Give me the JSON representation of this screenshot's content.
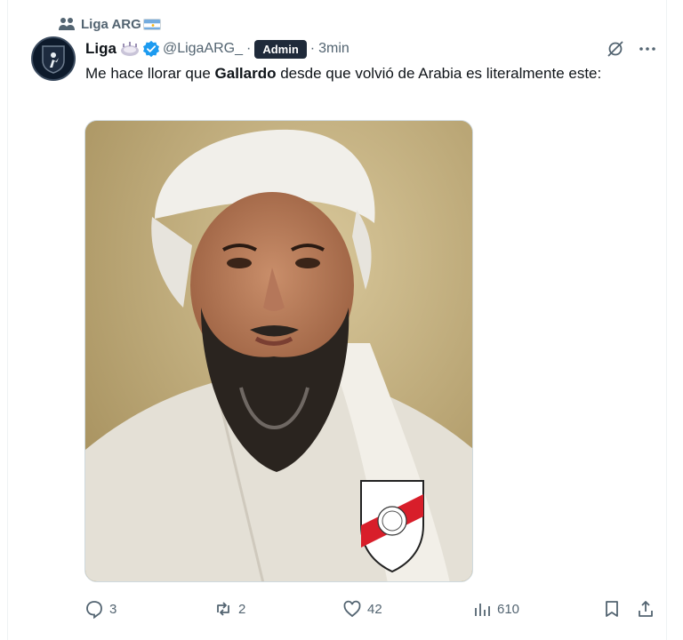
{
  "community": {
    "name": "Liga ARG",
    "flag_icon": "argentina-flag-icon",
    "icon": "people-icon"
  },
  "author": {
    "display_name": "Liga",
    "handle": "@LigaARG_",
    "role_badge": "Admin",
    "time": "3min",
    "verified_color": "#1d9bf0"
  },
  "tweet": {
    "text_before": "Me hace llorar que ",
    "bold": "Gallardo",
    "text_after": " desde que volvió de Arabia es literalmente este:"
  },
  "actions": {
    "replies": "3",
    "reposts": "2",
    "likes": "42",
    "views": "610"
  },
  "colors": {
    "muted": "#536471",
    "text": "#0f1419",
    "badge_bg": "#1f2a3a",
    "accent": "#1d9bf0"
  }
}
